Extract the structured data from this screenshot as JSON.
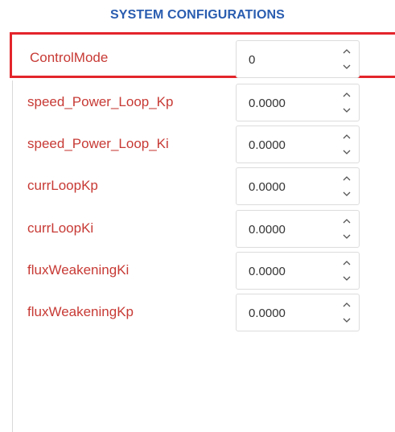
{
  "header": {
    "title": "SYSTEM CONFIGURATIONS"
  },
  "params": [
    {
      "name": "ControlMode",
      "value": "0"
    },
    {
      "name": "speed_Power_Loop_Kp",
      "value": "0.0000"
    },
    {
      "name": "speed_Power_Loop_Ki",
      "value": "0.0000"
    },
    {
      "name": "currLoopKp",
      "value": "0.0000"
    },
    {
      "name": "currLoopKi",
      "value": "0.0000"
    },
    {
      "name": "fluxWeakeningKi",
      "value": "0.0000"
    },
    {
      "name": "fluxWeakeningKp",
      "value": "0.0000"
    }
  ],
  "colors": {
    "title": "#2a5db0",
    "label": "#c73a35",
    "highlight": "#e3252b"
  },
  "icons": {
    "increment": "chevron-up-icon",
    "decrement": "chevron-down-icon"
  }
}
